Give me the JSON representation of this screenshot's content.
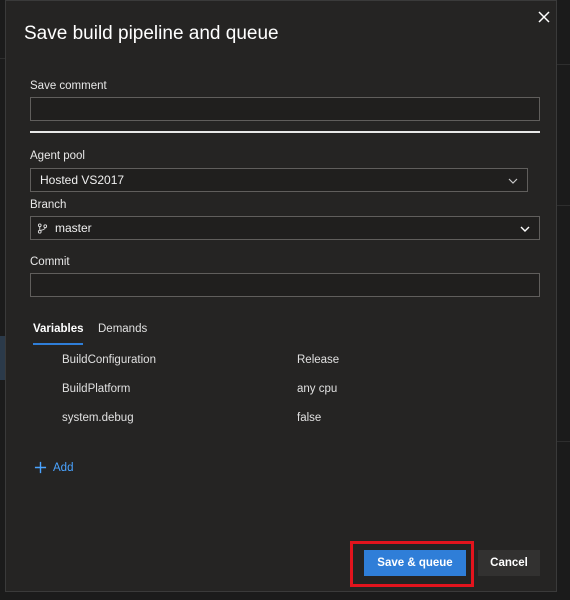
{
  "dialog": {
    "title": "Save build pipeline and queue",
    "close_icon": "close-icon"
  },
  "form": {
    "save_comment_label": "Save comment",
    "save_comment_value": "",
    "agent_pool_label": "Agent pool",
    "agent_pool_value": "Hosted VS2017",
    "branch_label": "Branch",
    "branch_value": "master",
    "commit_label": "Commit",
    "commit_value": ""
  },
  "tabs": {
    "variables": "Variables",
    "demands": "Demands",
    "active": "Variables"
  },
  "variables": [
    {
      "name": "BuildConfiguration",
      "value": "Release"
    },
    {
      "name": "BuildPlatform",
      "value": "any cpu"
    },
    {
      "name": "system.debug",
      "value": "false"
    }
  ],
  "add_label": "Add",
  "buttons": {
    "save_queue": "Save & queue",
    "cancel": "Cancel"
  },
  "colors": {
    "accent": "#2f7ed8",
    "highlight": "#e3141d",
    "dialog_bg": "#252423"
  }
}
